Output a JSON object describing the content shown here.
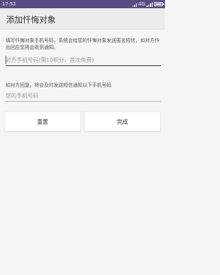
{
  "status_bar": {
    "time": "17:52",
    "network": "4G"
  },
  "app_bar": {
    "title": "添加忏悔对象"
  },
  "form": {
    "description": "填写忏悔对象手机号码，系统会给您的忏悔对象发送匿名短信，如对方作出回应您将会收到通知。",
    "target_phone": {
      "value": "",
      "placeholder": "对方手机号码(需10积分，首次免费)"
    },
    "reply_hint": "如对方回复，将会及时发送短信通知以下手机号码",
    "my_phone": {
      "value": "",
      "placeholder": "您的手机号码"
    }
  },
  "buttons": {
    "reset_label": "重置",
    "done_label": "完成"
  }
}
